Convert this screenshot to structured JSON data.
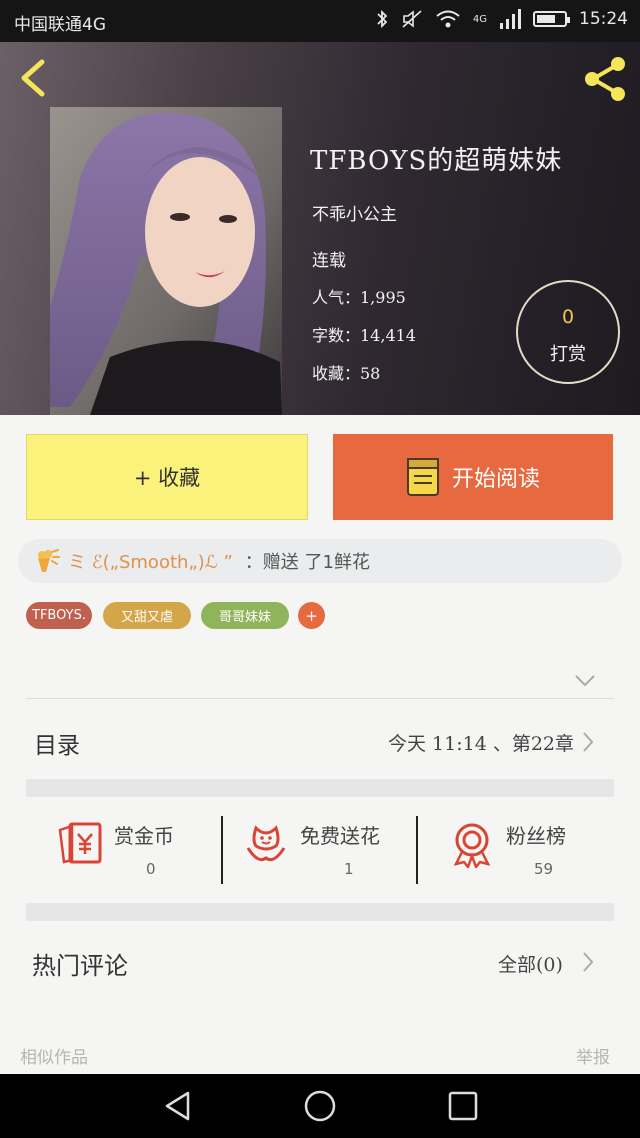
{
  "status_bar": {
    "carrier": "中国联通4G",
    "time": "15:24",
    "network": "4G",
    "battery_level": 0.6
  },
  "book": {
    "title": "TFBOYS的超萌妹妹",
    "author": "不乖小公主",
    "status": "连载",
    "popularity": "人气：1,995",
    "word_count": "字数：14,414",
    "favorites": "收藏：58"
  },
  "reward": {
    "count": "0",
    "label": "打赏"
  },
  "actions": {
    "favorite_label": "+ 收藏",
    "read_label": "开始阅读"
  },
  "gift_notice": {
    "user": "ミ ℰ(„Smooth„)ℒ ”",
    "action": "：赠送 了1鲜花"
  },
  "tags": [
    "TFBOYS.",
    "又甜又虐",
    "哥哥妹妹"
  ],
  "tag_add": "+",
  "catalog": {
    "label": "目录",
    "latest": "今天 11:14 、第22章"
  },
  "stats": [
    {
      "label": "赏金币",
      "value": "0",
      "icon": "red-envelope-icon"
    },
    {
      "label": "免费送花",
      "value": "1",
      "icon": "flower-icon"
    },
    {
      "label": "粉丝榜",
      "value": "59",
      "icon": "medal-icon"
    }
  ],
  "comments": {
    "label": "热门评论",
    "all_label": "全部(0)"
  },
  "footer": {
    "similar": "相似作品",
    "report": "举报"
  },
  "colors": {
    "accent_orange": "#e7693f",
    "favorite_yellow": "#faf27b",
    "reward_gold": "#f0c45a",
    "tag_red": "#c0614f",
    "tag_gold": "#d3a64a",
    "tag_green": "#8fb45b"
  },
  "icons": {
    "back": "back-arrow-icon",
    "share": "share-icon",
    "book": "book-icon",
    "gift": "bouquet-icon",
    "chevron_down": "chevron-down-icon",
    "chevron_right": "chevron-right-icon"
  }
}
